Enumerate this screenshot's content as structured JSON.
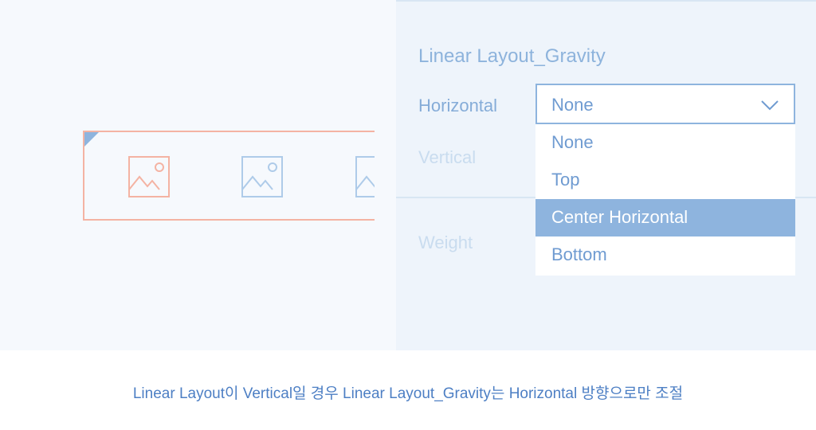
{
  "panel": {
    "title": "Linear Layout_Gravity",
    "horizontal_label": "Horizontal",
    "vertical_label": "Vertical",
    "weight_label": "Weight"
  },
  "dropdown": {
    "selected_value": "None",
    "options": [
      "None",
      "Top",
      "Center Horizontal",
      "Bottom"
    ],
    "highlighted_option": "Center Horizontal"
  },
  "preview": {
    "image_placeholders": 3
  },
  "colors": {
    "accent": "#8eb4de",
    "layout_border": "#f4b3a3",
    "text_blue": "#6f9bd1",
    "caption_blue": "#4d7fc4"
  },
  "icons": [
    "image-placeholder-icon",
    "chevron-down-icon"
  ],
  "caption": "Linear Layout이 Vertical일 경우 Linear Layout_Gravity는 Horizontal 방향으로만 조절"
}
